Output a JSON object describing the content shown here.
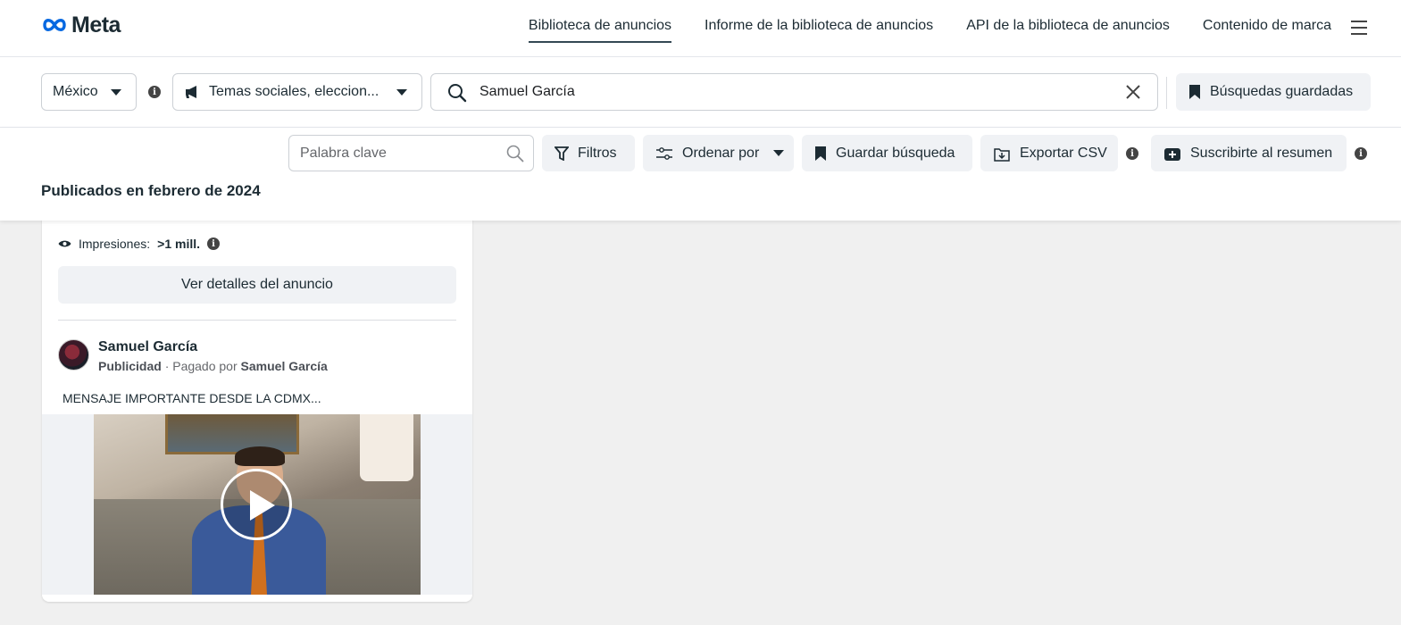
{
  "brand": {
    "name": "Meta"
  },
  "nav": {
    "links": [
      "Biblioteca de anuncios",
      "Informe de la biblioteca de anuncios",
      "API de la biblioteca de anuncios",
      "Contenido de marca"
    ]
  },
  "search": {
    "country": "México",
    "category": "Temas sociales, eleccion...",
    "query": "Samuel García",
    "saved_label": "Búsquedas guardadas"
  },
  "filters": {
    "keyword_placeholder": "Palabra clave",
    "filters_label": "Filtros",
    "sort_label": "Ordenar por",
    "save_label": "Guardar búsqueda",
    "export_label": "Exportar CSV",
    "subscribe_label": "Suscribirte al resumen"
  },
  "results": {
    "section_title": "Publicados en febrero de 2024"
  },
  "ad_card": {
    "impressions_label": "Impresiones:",
    "impressions_value": ">1 mill.",
    "details_label": "Ver detalles del anuncio",
    "advertiser": "Samuel García",
    "type_label": "Publicidad",
    "paid_by_prefix": "· Pagado por",
    "paid_by": "Samuel García",
    "body": "MENSAJE IMPORTANTE DESDE LA CDMX..."
  },
  "colors": {
    "accent_underline": "#344854",
    "button_bg": "#f0f2f5",
    "meta_blue": "#0668e1"
  }
}
